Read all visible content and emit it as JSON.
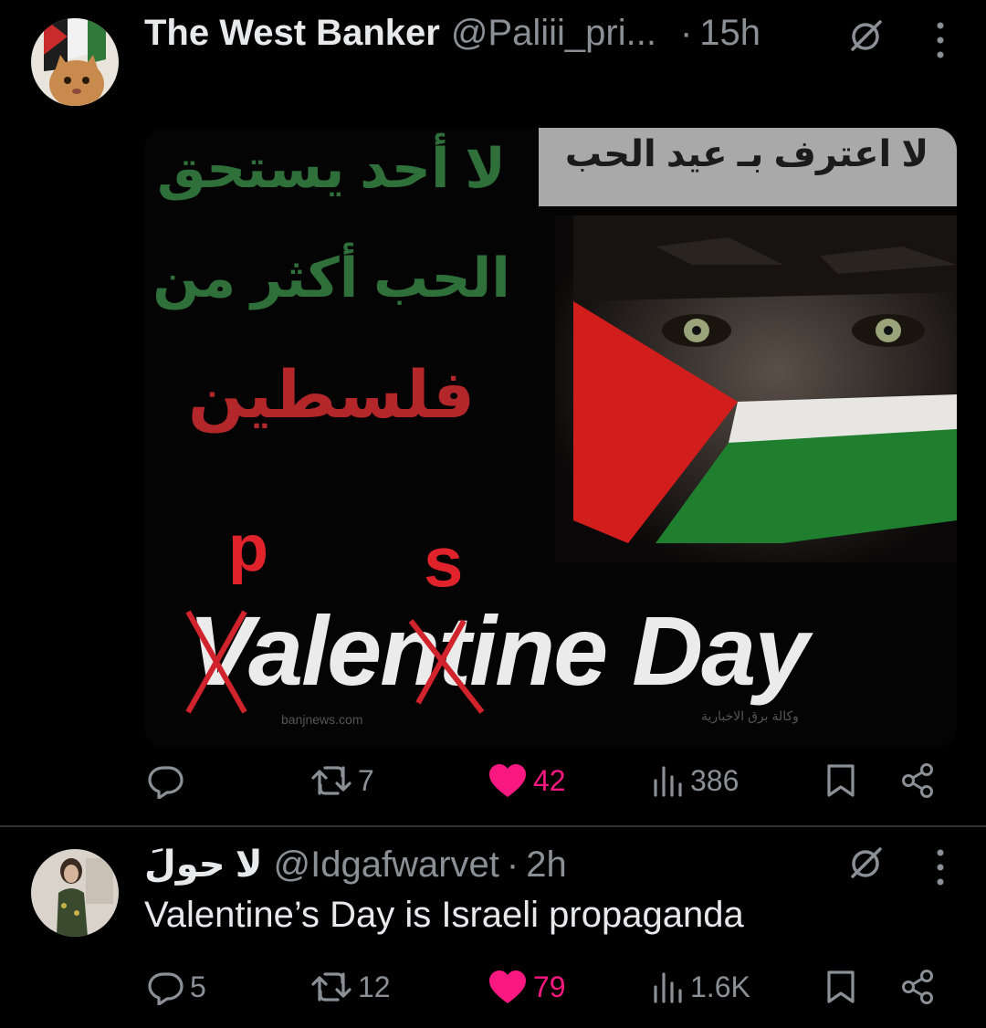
{
  "tweet1": {
    "author_name": "The West Banker",
    "handle": "@Paliii_pri...",
    "separator": "·",
    "time": "15h",
    "image": {
      "arabic_top_right": "لا اعترف بـ عيد الحب",
      "arabic_line1": "لا أحد يستحق",
      "arabic_line2": "الحب أكثر من",
      "arabic_line3": "فلسطين",
      "correction_p": "p",
      "correction_s": "s",
      "main_text": "Valentine Day",
      "watermark_left": "banjnews.com",
      "watermark_right": "وكالة برق الاخبارية"
    },
    "actions": {
      "replies": "",
      "reposts": "7",
      "likes": "42",
      "views": "386"
    },
    "colors": {
      "like": "#f91880",
      "muted": "#8b9096"
    }
  },
  "tweet2": {
    "author_name": "لا حولَ",
    "handle": "@Idgafwarvet",
    "separator": "·",
    "time": "2h",
    "text": "Valentine’s Day is Israeli propaganda",
    "actions": {
      "replies": "5",
      "reposts": "12",
      "likes": "79",
      "views": "1.6K"
    }
  }
}
